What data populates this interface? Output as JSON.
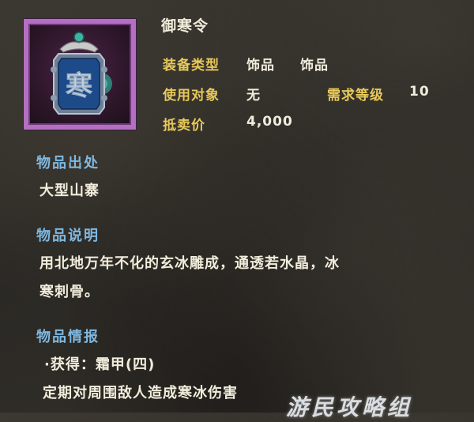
{
  "item": {
    "name": "御寒令",
    "icon": "cold-token-icon",
    "icon_glyph": "寒"
  },
  "attributes": {
    "type_label": "装备类型",
    "type_value_1": "饰品",
    "type_value_2": "饰品",
    "target_label": "使用对象",
    "target_value": "无",
    "level_label": "需求等级",
    "level_value": "10",
    "price_label": "抵卖价",
    "price_value": "4,000"
  },
  "source": {
    "title": "物品出处",
    "text": "大型山寨"
  },
  "description": {
    "title": "物品说明",
    "line1": "用北地万年不化的玄冰雕成，通透若水晶，冰",
    "line2": "寒刺骨。"
  },
  "info": {
    "title": "物品情报",
    "line1": "·获得：霜甲(四)",
    "line2": "定期对周围敌人造成寒冰伤害"
  },
  "watermark": "游民攻略组",
  "colors": {
    "frame": "#b46fc2",
    "label": "#e8c95a",
    "section": "#7fb8e0",
    "text": "#f2ecdc"
  }
}
